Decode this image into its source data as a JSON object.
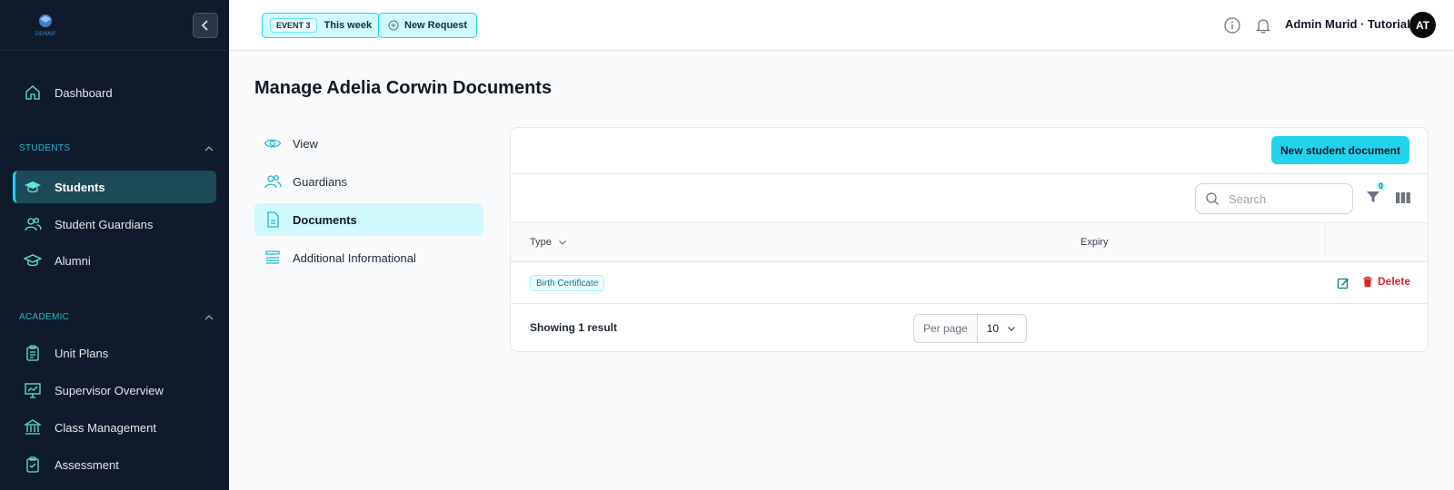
{
  "sidebar": {
    "logo_text": "DEMAIF",
    "items_top": [
      {
        "label": "Dashboard",
        "icon": "home-icon"
      }
    ],
    "sections": [
      {
        "label": "STUDENTS",
        "items": [
          {
            "label": "Students",
            "icon": "graduation-cap-icon",
            "active": true
          },
          {
            "label": "Student Guardians",
            "icon": "users-icon"
          },
          {
            "label": "Alumni",
            "icon": "graduation-icon"
          }
        ]
      },
      {
        "label": "ACADEMIC",
        "items": [
          {
            "label": "Unit Plans",
            "icon": "clipboard-icon"
          },
          {
            "label": "Supervisor Overview",
            "icon": "presentation-chart-icon"
          },
          {
            "label": "Class Management",
            "icon": "building-library-icon"
          },
          {
            "label": "Assessment",
            "icon": "clipboard-check-icon"
          }
        ]
      }
    ]
  },
  "topbar": {
    "event_badge": "EVENT 3",
    "event_label": "This week",
    "new_request": "New Request",
    "user_name": "Admin Murid · Tutorial",
    "avatar_initials": "AT"
  },
  "page": {
    "title": "Manage Adelia Corwin Documents",
    "sub_nav": [
      {
        "label": "View",
        "icon": "eye-icon"
      },
      {
        "label": "Guardians",
        "icon": "users-icon"
      },
      {
        "label": "Documents",
        "icon": "document-icon",
        "active": true
      },
      {
        "label": "Additional Informational",
        "icon": "list-icon"
      }
    ]
  },
  "table": {
    "new_button": "New student document",
    "search_placeholder": "Search",
    "filter_count": "0",
    "columns": {
      "type": "Type",
      "expiry": "Expiry"
    },
    "rows": [
      {
        "type": "Birth Certificate",
        "expiry": ""
      }
    ],
    "delete_label": "Delete",
    "showing": "Showing 1 result",
    "per_page_label": "Per page",
    "per_page_value": "10"
  },
  "colors": {
    "accent": "#22d3ee",
    "sidebar_bg": "#0f1b2d",
    "danger": "#dc2626"
  }
}
